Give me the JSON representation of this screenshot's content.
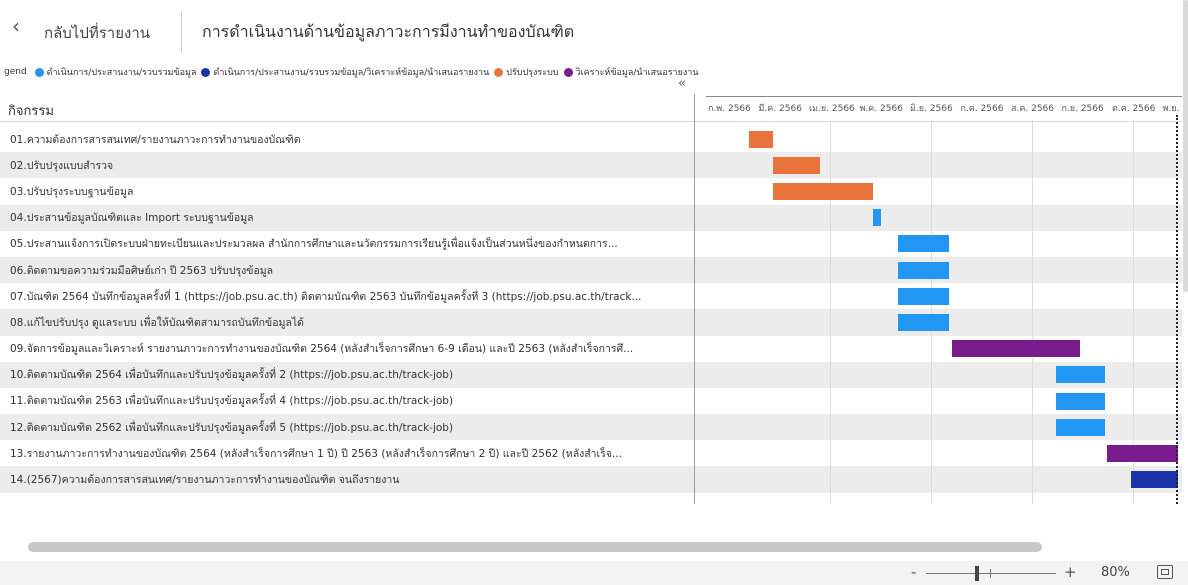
{
  "header": {
    "back_icon": "‹",
    "back_label": "กลับไปที่รายงาน",
    "title": "การดำเนินงานด้านข้อมูลภาวะการมีงานทำของบัณฑิต"
  },
  "legend": {
    "title": "gend",
    "items": [
      {
        "label": "ดำเนินการ/ประสานงาน/รวบรวมข้อมูล",
        "color": "#2196F3"
      },
      {
        "label": "ดำเนินการ/ประสานงาน/รวบรวมข้อมูล/วิเคราะห์ข้อมูล/นำเสนอรายงาน",
        "color": "#1A33A8"
      },
      {
        "label": "ปรับปรุงระบบ",
        "color": "#E8743B"
      },
      {
        "label": "วิเคราะห์ข้อมูล/นำเสนอรายงาน",
        "color": "#7B1C8E"
      }
    ]
  },
  "collapse_icon": "«",
  "column_header": "กิจกรรม",
  "timeline": {
    "months": [
      "ก.พ. 2566",
      "มี.ค. 2566",
      "เม.ย. 2566",
      "พ.ค. 2566",
      "มิ.ย. 2566",
      "ก.ค. 2566",
      "ส.ค. 2566",
      "ก.ย. 2566",
      "ต.ค. 2566",
      "พ.ย."
    ]
  },
  "tasks": [
    {
      "label": "01.ความต้องการสารสนเทศ/รายงานภาวะการทำงานของบัณฑิต",
      "start": 0.85,
      "end": 1.32,
      "category": "ปรับปรุงระบบ",
      "color": "#E8743B"
    },
    {
      "label": "02.ปรับปรุงแบบสำรวจ",
      "start": 1.32,
      "end": 2.25,
      "category": "ปรับปรุงระบบ",
      "color": "#E8743B"
    },
    {
      "label": "03.ปรับปรุงระบบฐานข้อมูล",
      "start": 1.32,
      "end": 3.3,
      "category": "ปรับปรุงระบบ",
      "color": "#E8743B"
    },
    {
      "label": "04.ประสานข้อมูลบัณฑิตและ Import ระบบฐานข้อมูล",
      "start": 3.3,
      "end": 3.47,
      "category": "ดำเนินการ/ประสานงาน/รวบรวมข้อมูล",
      "color": "#2196F3"
    },
    {
      "label": "05.ประสานแจ้งการเปิดระบบฝ่ายทะเบียนและประมวลผล สำนักการศึกษาและนวัตกรรมการเรียนรู้เพื่อแจ้งเป็นส่วนหนึ่งของกำหนดการ...",
      "start": 3.8,
      "end": 4.82,
      "category": "ดำเนินการ/ประสานงาน/รวบรวมข้อมูล",
      "color": "#2196F3"
    },
    {
      "label": "06.ติดตามขอความร่วมมือศิษย์เก่า ปี 2563 ปรับปรุงข้อมูล",
      "start": 3.8,
      "end": 4.82,
      "category": "ดำเนินการ/ประสานงาน/รวบรวมข้อมูล",
      "color": "#2196F3"
    },
    {
      "label": "07.บัณฑิต 2564 บันทึกข้อมูลครั้งที่ 1 (https://job.psu.ac.th) ติดตามบัณฑิต 2563 บันทึกข้อมูลครั้งที่ 3 (https://job.psu.ac.th/track...",
      "start": 3.8,
      "end": 4.82,
      "category": "ดำเนินการ/ประสานงาน/รวบรวมข้อมูล",
      "color": "#2196F3"
    },
    {
      "label": "08.แก้ไขปรับปรุง ดูแลระบบ เพื่อให้บัณฑิตสามารถบันทึกข้อมูลได้",
      "start": 3.8,
      "end": 4.82,
      "category": "ดำเนินการ/ประสานงาน/รวบรวมข้อมูล",
      "color": "#2196F3"
    },
    {
      "label": "09.จัดการข้อมูลและวิเคราะห์ รายงานภาวะการทำงานของบัณฑิต 2564 (หลังสำเร็จการศึกษา 6-9 เดือน) และปี 2563 (หลังสำเร็จการศึ...",
      "start": 4.88,
      "end": 7.4,
      "category": "วิเคราะห์ข้อมูล/นำเสนอรายงาน",
      "color": "#7B1C8E"
    },
    {
      "label": "10.ติดตามบัณฑิต 2564 เพื่อบันทึกและปรับปรุงข้อมูลครั้งที่ 2 (https://job.psu.ac.th/track-job)",
      "start": 6.93,
      "end": 7.9,
      "category": "ดำเนินการ/ประสานงาน/รวบรวมข้อมูล",
      "color": "#2196F3"
    },
    {
      "label": "11.ติดตามบัณฑิต 2563 เพื่อบันทึกและปรับปรุงข้อมูลครั้งที่ 4 (https://job.psu.ac.th/track-job)",
      "start": 6.93,
      "end": 7.9,
      "category": "ดำเนินการ/ประสานงาน/รวบรวมข้อมูล",
      "color": "#2196F3"
    },
    {
      "label": "12.ติดตามบัณฑิต 2562 เพื่อบันทึกและปรับปรุงข้อมูลครั้งที่ 5 (https://job.psu.ac.th/track-job)",
      "start": 6.93,
      "end": 7.9,
      "category": "ดำเนินการ/ประสานงาน/รวบรวมข้อมูล",
      "color": "#2196F3"
    },
    {
      "label": "13.รายงานภาวะการทำงานของบัณฑิต 2564 (หลังสำเร็จการศึกษา 1 ปี) ปี 2563 (หลังสำเร็จการศึกษา 2 ปี) และปี 2562 (หลังสำเร็จ...",
      "start": 7.95,
      "end": 9.45,
      "category": "วิเคราะห์ข้อมูล/นำเสนอรายงาน",
      "color": "#7B1C8E"
    },
    {
      "label": "14.(2567)ความต้องการสารสนเทศ/รายงานภาวะการทำงานของบัณฑิต จนถึงรายงาน",
      "start": 8.42,
      "end": 9.99,
      "category": "ดำเนินการ/ประสานงาน/รวบรวมข้อมูล/วิเคราะห์ข้อมูล/นำเสนอรายงาน",
      "color": "#1A33A8"
    }
  ],
  "today_marker": 9.3,
  "zoom": {
    "minus": "-",
    "plus": "+",
    "level": "80%",
    "slider_value": 0.38
  }
}
